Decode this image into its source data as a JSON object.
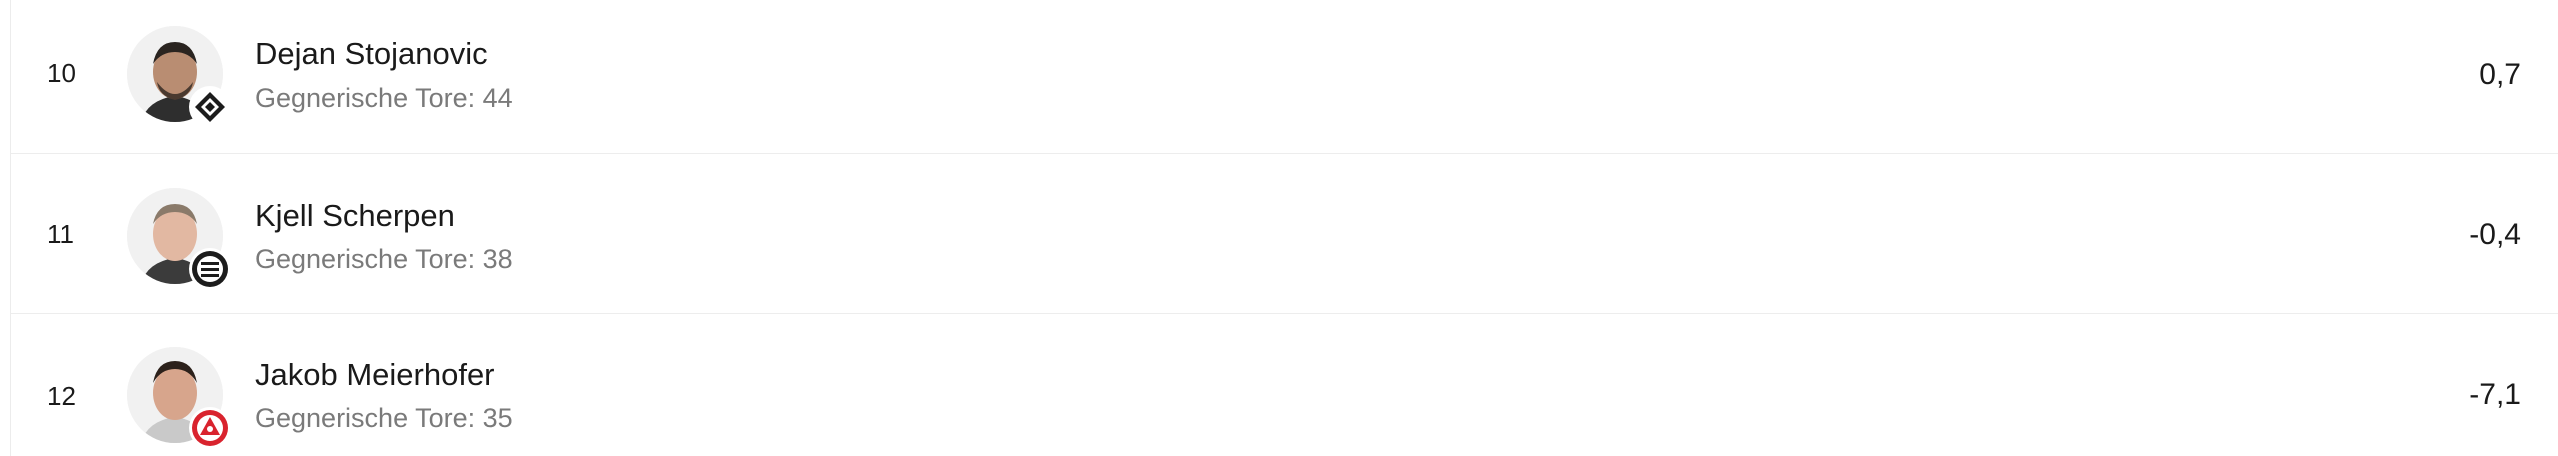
{
  "rows": [
    {
      "rank": "10",
      "name": "Dejan Stojanovic",
      "stat_label": "Gegnerische Tore: 44",
      "value": "0,7",
      "club_icon": "diamond-crest-icon",
      "club_color": "#1c1c1c"
    },
    {
      "rank": "11",
      "name": "Kjell Scherpen",
      "stat_label": "Gegnerische Tore: 38",
      "value": "-0,4",
      "club_icon": "striped-crest-icon",
      "club_color": "#1c1c1c"
    },
    {
      "rank": "12",
      "name": "Jakob Meierhofer",
      "stat_label": "Gegnerische Tore: 35",
      "value": "-7,1",
      "club_icon": "red-crest-icon",
      "club_color": "#d9232e"
    }
  ]
}
